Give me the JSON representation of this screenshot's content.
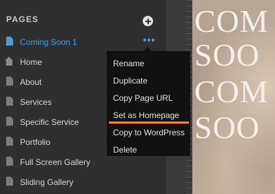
{
  "sidebar": {
    "header": "PAGES",
    "pages": [
      {
        "label": "Coming Soon 1",
        "icon": "page-icon",
        "active": true
      },
      {
        "label": "Home",
        "icon": "home-icon"
      },
      {
        "label": "About",
        "icon": "page-icon"
      },
      {
        "label": "Services",
        "icon": "page-icon"
      },
      {
        "label": "Specific Service",
        "icon": "page-icon"
      },
      {
        "label": "Portfolio",
        "icon": "page-icon"
      },
      {
        "label": "Full Screen Gallery",
        "icon": "page-icon"
      },
      {
        "label": "Sliding Gallery",
        "icon": "page-icon"
      }
    ]
  },
  "context_menu": {
    "items": [
      {
        "label": "Rename"
      },
      {
        "label": "Duplicate"
      },
      {
        "label": "Copy Page URL"
      },
      {
        "label": "Set as Homepage",
        "highlighted": true
      },
      {
        "label": "Copy to WordPress"
      },
      {
        "label": "Delete"
      }
    ]
  },
  "canvas": {
    "lines": [
      "COM",
      "SOO",
      "COM",
      "SOO"
    ]
  },
  "colors": {
    "accent": "#4a9ee0",
    "highlight": "#f08b2b",
    "sidebar_bg": "#2f2f2f",
    "menu_bg": "#111111"
  }
}
